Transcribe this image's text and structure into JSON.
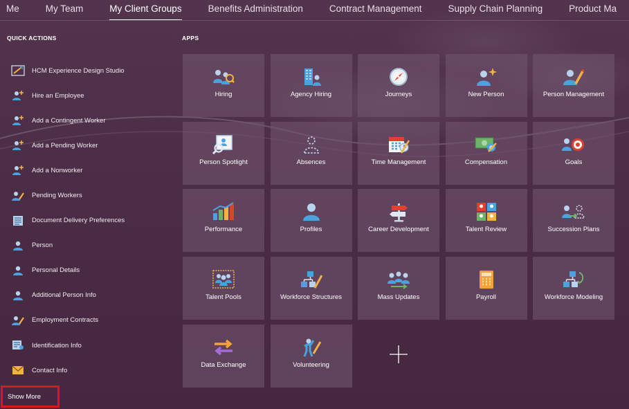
{
  "nav": {
    "tabs": [
      "Me",
      "My Team",
      "My Client Groups",
      "Benefits Administration",
      "Contract Management",
      "Supply Chain Planning",
      "Product Ma"
    ],
    "active_index": 2
  },
  "quick_actions": {
    "title": "QUICK ACTIONS",
    "items": [
      {
        "label": "HCM Experience Design Studio",
        "icon": "design-studio-icon"
      },
      {
        "label": "Hire an Employee",
        "icon": "add-person-icon"
      },
      {
        "label": "Add a Contingent Worker",
        "icon": "add-person-icon"
      },
      {
        "label": "Add a Pending Worker",
        "icon": "add-person-icon"
      },
      {
        "label": "Add a Nonworker",
        "icon": "add-person-icon"
      },
      {
        "label": "Pending Workers",
        "icon": "person-edit-icon"
      },
      {
        "label": "Document Delivery Preferences",
        "icon": "document-icon"
      },
      {
        "label": "Person",
        "icon": "person-icon"
      },
      {
        "label": "Personal Details",
        "icon": "person-icon"
      },
      {
        "label": "Additional Person Info",
        "icon": "person-icon"
      },
      {
        "label": "Employment Contracts",
        "icon": "person-edit-icon"
      },
      {
        "label": "Identification Info",
        "icon": "id-card-icon"
      },
      {
        "label": "Contact Info",
        "icon": "envelope-icon"
      }
    ],
    "show_more": "Show More"
  },
  "apps": {
    "title": "APPS",
    "tiles": [
      {
        "label": "Hiring",
        "icon": "hiring-icon"
      },
      {
        "label": "Agency Hiring",
        "icon": "agency-hiring-icon"
      },
      {
        "label": "Journeys",
        "icon": "compass-icon"
      },
      {
        "label": "New Person",
        "icon": "new-person-icon"
      },
      {
        "label": "Person Management",
        "icon": "person-management-icon"
      },
      {
        "label": "Person Spotlight",
        "icon": "spotlight-icon"
      },
      {
        "label": "Absences",
        "icon": "absences-icon"
      },
      {
        "label": "Time Management",
        "icon": "calendar-icon"
      },
      {
        "label": "Compensation",
        "icon": "compensation-icon"
      },
      {
        "label": "Goals",
        "icon": "goals-icon"
      },
      {
        "label": "Performance",
        "icon": "performance-chart-icon"
      },
      {
        "label": "Profiles",
        "icon": "profile-icon"
      },
      {
        "label": "Career Development",
        "icon": "signpost-icon"
      },
      {
        "label": "Talent Review",
        "icon": "talent-review-icon"
      },
      {
        "label": "Succession Plans",
        "icon": "succession-icon"
      },
      {
        "label": "Talent Pools",
        "icon": "talent-pools-icon"
      },
      {
        "label": "Workforce Structures",
        "icon": "workforce-structures-icon"
      },
      {
        "label": "Mass Updates",
        "icon": "mass-updates-icon"
      },
      {
        "label": "Payroll",
        "icon": "calculator-icon"
      },
      {
        "label": "Workforce Modeling",
        "icon": "workforce-modeling-icon"
      },
      {
        "label": "Data Exchange",
        "icon": "exchange-arrows-icon"
      },
      {
        "label": "Volunteering",
        "icon": "volunteering-icon"
      }
    ],
    "add_icon": "plus-icon"
  }
}
